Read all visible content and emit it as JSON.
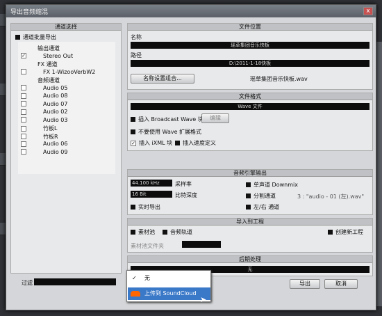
{
  "dialog": {
    "title": "导出音频缩混",
    "close": "x"
  },
  "left": {
    "header": "通道选择",
    "batch": "通道批量导出",
    "filter_label": "过滤",
    "items": [
      {
        "label": "输出通道",
        "indent": 1,
        "checkbox": false
      },
      {
        "label": "Stereo Out",
        "indent": 2,
        "checkbox": true,
        "checked": true
      },
      {
        "label": "FX 通道",
        "indent": 1,
        "checkbox": false
      },
      {
        "label": "FX 1-WizooVerbW2",
        "indent": 2,
        "checkbox": true
      },
      {
        "label": "音频通道",
        "indent": 1,
        "checkbox": false
      },
      {
        "label": "Audio 05",
        "indent": 2,
        "checkbox": true
      },
      {
        "label": "Audio 08",
        "indent": 2,
        "checkbox": true
      },
      {
        "label": "Audio 07",
        "indent": 2,
        "checkbox": true
      },
      {
        "label": "Audio 02",
        "indent": 2,
        "checkbox": true
      },
      {
        "label": "Audio 03",
        "indent": 2,
        "checkbox": true
      },
      {
        "label": "竹板L",
        "indent": 2,
        "checkbox": true
      },
      {
        "label": "竹板R",
        "indent": 2,
        "checkbox": true
      },
      {
        "label": "Audio 06",
        "indent": 2,
        "checkbox": true
      },
      {
        "label": "Audio 09",
        "indent": 2,
        "checkbox": true
      }
    ]
  },
  "file_location": {
    "header": "文件位置",
    "name_label": "名称",
    "name_value": "瑶草集团音乐快板",
    "path_label": "路径",
    "path_value": "D:\\2011-1-18快板",
    "naming_button": "名称设置组合...",
    "filename": "瑶草集团音乐快板.wav"
  },
  "file_format": {
    "header": "文件格式",
    "format": "Wave 文件",
    "broadcast": "插入 Broadcast Wave 块",
    "edit_button": "编辑",
    "no_wave_ext": "不要使用 Wave 扩展格式",
    "ixml": "插入 iXML 块",
    "tempo": "插入速度定义"
  },
  "engine": {
    "header": "音频引擎输出",
    "sample_rate": "44.100 kHz",
    "sample_rate_label": "采样率",
    "bit_depth": "16 Bit",
    "bit_depth_label": "比特深度",
    "realtime": "实时导出",
    "mono": "单声道 Downmix",
    "split": "分割通道",
    "split_value": "3 : \"audio - 01 (左).wav\"",
    "lr": "左/右 通道"
  },
  "import": {
    "header": "导入到工程",
    "pool": "素材池",
    "audio_track": "音频轨道",
    "new_project": "创建新工程",
    "pool_folder": "素材池文件夹"
  },
  "post": {
    "header": "后期处理",
    "value": "无"
  },
  "buttons": {
    "export": "导出",
    "cancel": "取消"
  },
  "popup": {
    "items": [
      "无",
      "上传到 SoundCloud"
    ]
  }
}
